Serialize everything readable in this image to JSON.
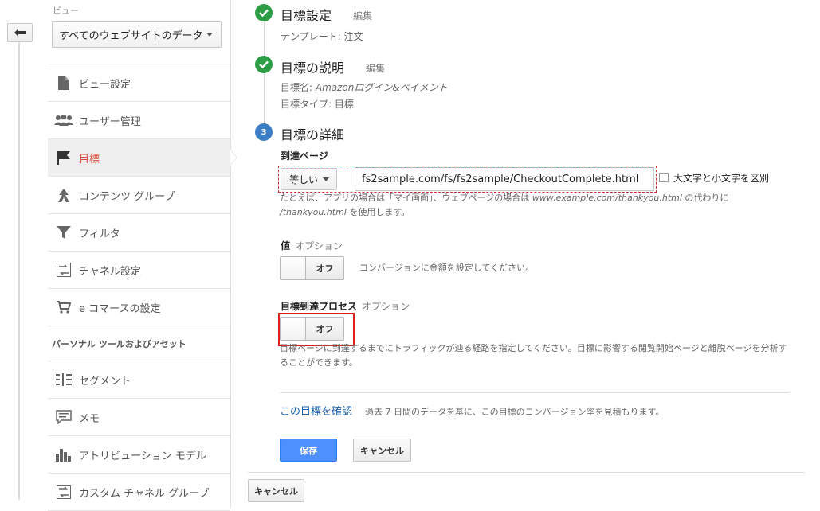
{
  "view": {
    "label": "ビュー",
    "selected": "すべてのウェブサイトのデータ"
  },
  "sidebar": {
    "items": [
      {
        "label": "ビュー設定",
        "icon": "document-icon"
      },
      {
        "label": "ユーザー管理",
        "icon": "users-icon"
      },
      {
        "label": "目標",
        "icon": "flag-icon",
        "active": true
      },
      {
        "label": "コンテンツ グループ",
        "icon": "content-group-icon"
      },
      {
        "label": "フィルタ",
        "icon": "filter-icon"
      },
      {
        "label": "チャネル設定",
        "icon": "channel-icon"
      },
      {
        "label": "e コマースの設定",
        "icon": "cart-icon"
      }
    ],
    "section_title": "パーソナル ツールおよびアセット",
    "personal_items": [
      {
        "label": "セグメント",
        "icon": "segment-icon"
      },
      {
        "label": "メモ",
        "icon": "memo-icon"
      },
      {
        "label": "アトリビューション モデル",
        "icon": "attribution-icon"
      },
      {
        "label": "カスタム チャネル グループ",
        "icon": "custom-channel-icon"
      }
    ]
  },
  "steps": {
    "setup": {
      "title": "目標設定",
      "edit": "編集",
      "detail": "テンプレート: 注文"
    },
    "description": {
      "title": "目標の説明",
      "edit": "編集",
      "name_line": "目標名: ",
      "name_value": "Amazonログイン&ペイメント",
      "type_line": "目標タイプ: 目標"
    },
    "details": {
      "number": "3",
      "title": "目標の詳細"
    }
  },
  "destination": {
    "label": "到達ページ",
    "match_type": "等しい",
    "url": "fs2sample.com/fs/fs2sample/CheckoutComplete.html",
    "case_label": "大文字と小文字を区別",
    "help_1": "たとえば、アプリの場合は「マイ画面」、ウェブページの場合は ",
    "help_example_1": "www.example.com/thankyou.html",
    "help_2": " の代わりに ",
    "help_example_2": "/thankyou.html",
    "help_3": " を使用します。"
  },
  "value": {
    "label": "値",
    "option": "オプション",
    "toggle": "オフ",
    "desc": "コンバージョンに金額を設定してください。"
  },
  "funnel": {
    "label": "目標到達プロセス",
    "option": "オプション",
    "toggle": "オフ",
    "desc": "目標ページに到達するまでにトラフィックが辿る経路を指定してください。目標に影響する閲覧開始ページと離脱ページを分析することができます。"
  },
  "verify": {
    "link": "この目標を確認",
    "desc": "過去 7 日間のデータを基に、この目標のコンバージョン率を見積もります。"
  },
  "buttons": {
    "save": "保存",
    "cancel": "キャンセル",
    "cancel_bottom": "キャンセル"
  },
  "colors": {
    "accent": "#4d90fe",
    "done": "#2e9e46",
    "current": "#3b7ec6",
    "active_nav": "#dd4b39",
    "highlight": "#e02020"
  }
}
